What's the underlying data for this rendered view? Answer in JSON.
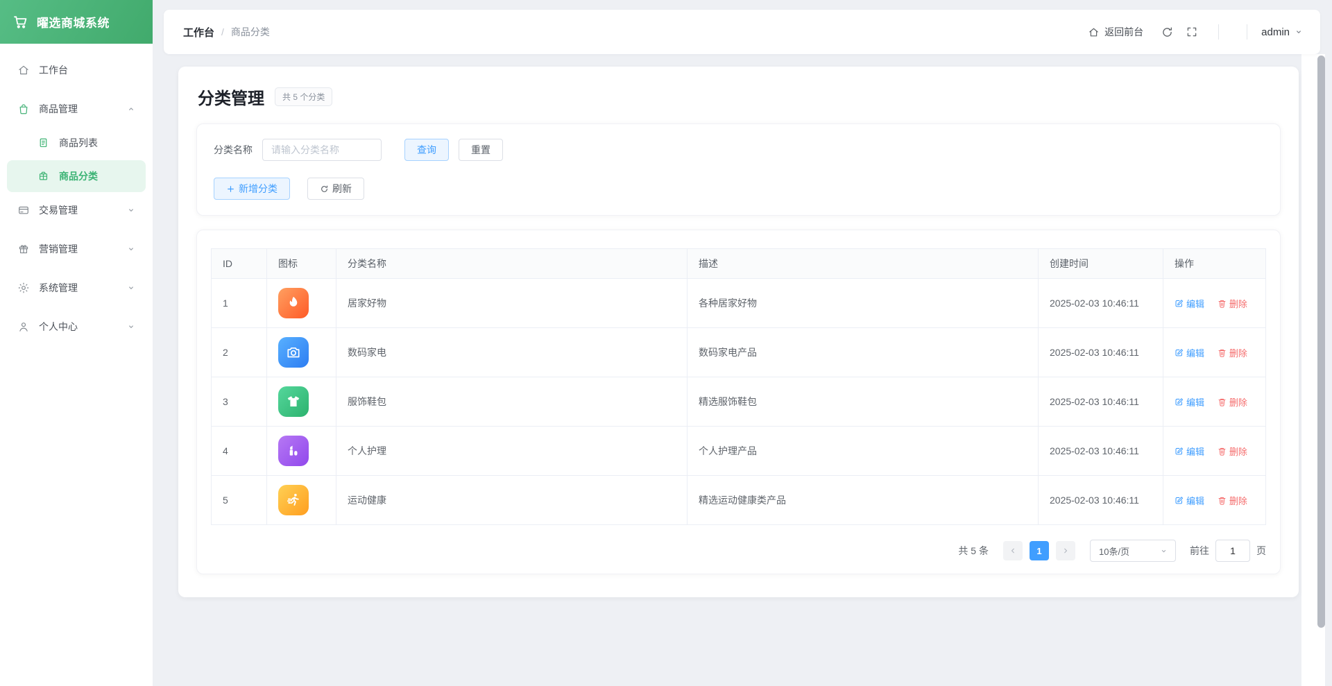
{
  "app": {
    "logo_title": "曜选商城系统"
  },
  "sidebar": {
    "items": [
      {
        "label": "工作台",
        "icon": "home"
      },
      {
        "label": "商品管理",
        "icon": "bag",
        "expanded": true
      },
      {
        "label": "商品列表",
        "icon": "list",
        "child": true
      },
      {
        "label": "商品分类",
        "icon": "category",
        "child": true,
        "active": true
      },
      {
        "label": "交易管理",
        "icon": "card"
      },
      {
        "label": "营销管理",
        "icon": "gift"
      },
      {
        "label": "系统管理",
        "icon": "gear"
      },
      {
        "label": "个人中心",
        "icon": "user"
      }
    ]
  },
  "topbar": {
    "breadcrumb": [
      "工作台",
      "商品分类"
    ],
    "breadcrumb_separator": "/",
    "back_front": "返回前台",
    "user": "admin"
  },
  "page": {
    "title": "分类管理",
    "count_badge": "共 5 个分类"
  },
  "search": {
    "label": "分类名称",
    "placeholder": "请输入分类名称",
    "query": "查询",
    "reset": "重置",
    "add": "新增分类",
    "refresh": "刷新"
  },
  "table": {
    "headers": [
      "ID",
      "图标",
      "分类名称",
      "描述",
      "创建时间",
      "操作"
    ],
    "edit": "编辑",
    "delete": "删除",
    "rows": [
      {
        "id": "1",
        "icon": "flame",
        "name": "居家好物",
        "desc": "各种居家好物",
        "created": "2025-02-03 10:46:11"
      },
      {
        "id": "2",
        "icon": "camera",
        "name": "数码家电",
        "desc": "数码家电产品",
        "created": "2025-02-03 10:46:11"
      },
      {
        "id": "3",
        "icon": "tshirt",
        "name": "服饰鞋包",
        "desc": "精选服饰鞋包",
        "created": "2025-02-03 10:46:11"
      },
      {
        "id": "4",
        "icon": "cosmetics",
        "name": "个人护理",
        "desc": "个人护理产品",
        "created": "2025-02-03 10:46:11"
      },
      {
        "id": "5",
        "icon": "runner",
        "name": "运动健康",
        "desc": "精选运动健康类产品",
        "created": "2025-02-03 10:46:11"
      }
    ]
  },
  "pagination": {
    "total": "共 5 条",
    "current_page": "1",
    "page_size": "10条/页",
    "goto_label": "前往",
    "goto_value": "1",
    "page_unit": "页"
  },
  "colors": {
    "primary_green": "#4db87a",
    "primary_blue": "#409eff",
    "danger_red": "#f56c6c",
    "sidebar_active_bg": "#e7f6ee",
    "row_icon_gradients": {
      "flame": [
        "#ffa061",
        "#ff5a26"
      ],
      "camera": [
        "#58b0ff",
        "#2d7df2"
      ],
      "tshirt": [
        "#55d79c",
        "#2cb26e"
      ],
      "cosmetics": [
        "#b678f4",
        "#9148ec"
      ],
      "runner": [
        "#ffd054",
        "#ff9e1f"
      ]
    }
  }
}
